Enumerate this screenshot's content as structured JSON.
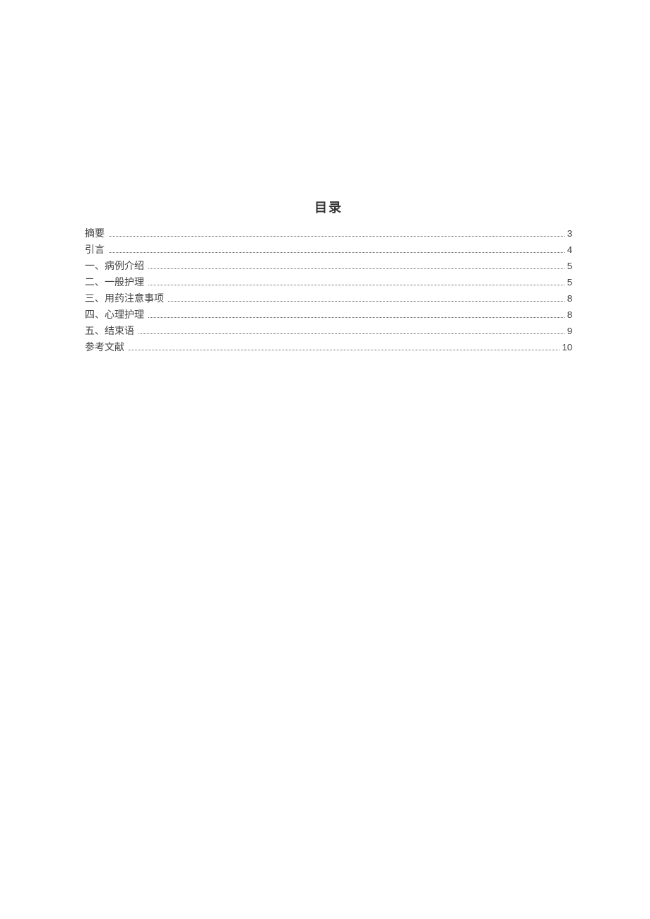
{
  "toc": {
    "title": "目录",
    "entries": [
      {
        "label": "摘要",
        "page": "3"
      },
      {
        "label": "引言",
        "page": "4"
      },
      {
        "label": "一、病例介绍",
        "page": "5"
      },
      {
        "label": "二、一般护理",
        "page": "5"
      },
      {
        "label": "三、用药注意事项",
        "page": "8"
      },
      {
        "label": "四、心理护理",
        "page": "8"
      },
      {
        "label": "五、结束语",
        "page": "9"
      },
      {
        "label": "参考文献",
        "page": "10"
      }
    ]
  }
}
